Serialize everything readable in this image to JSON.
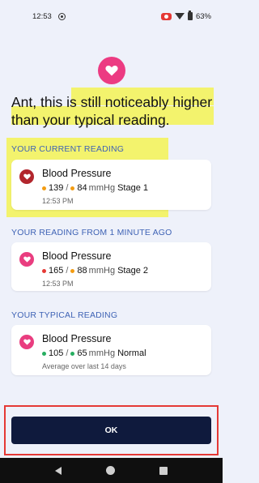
{
  "status_bar": {
    "time": "12:53",
    "battery": "63%"
  },
  "headline": {
    "part1": "Ant, this is ",
    "part2": "still noticeably higher",
    "part3": "than your typical reading."
  },
  "sections": [
    {
      "title": "YOUR CURRENT READING",
      "card": {
        "title": "Blood Pressure",
        "systolic": "139",
        "diastolic": "84",
        "unit": "mmHg",
        "status": "Stage 1",
        "subtitle": "12:53 PM",
        "systolic_color": "#f39c12",
        "diastolic_color": "#f39c12"
      }
    },
    {
      "title": "YOUR READING FROM 1 MINUTE AGO",
      "card": {
        "title": "Blood Pressure",
        "systolic": "165",
        "diastolic": "88",
        "unit": "mmHg",
        "status": "Stage 2",
        "subtitle": "12:53 PM",
        "systolic_color": "#e53935",
        "diastolic_color": "#f39c12"
      }
    },
    {
      "title": "YOUR TYPICAL READING",
      "card": {
        "title": "Blood Pressure",
        "systolic": "105",
        "diastolic": "65",
        "unit": "mmHg",
        "status": "Normal",
        "subtitle": "Average over last 14 days",
        "systolic_color": "#27ae60",
        "diastolic_color": "#27ae60"
      }
    }
  ],
  "ok_button": {
    "label": "OK"
  },
  "colors": {
    "accent_pink": "#ec3b82",
    "button_navy": "#0f1a3d",
    "section_blue": "#3f63b5",
    "highlight_yellow": "#f3f36d",
    "annotation_red": "#e53935"
  }
}
